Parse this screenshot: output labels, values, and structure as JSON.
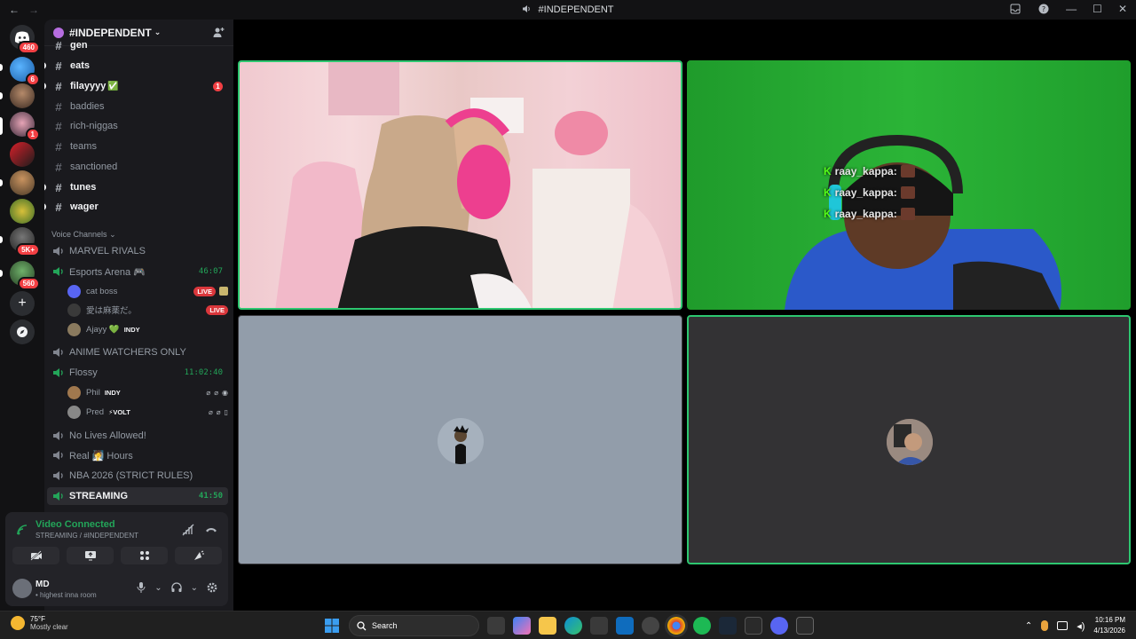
{
  "window": {
    "title": "#INDEPENDENT",
    "back": "←",
    "forward": "→",
    "minimize": "—",
    "maximize": "☐",
    "close": "✕"
  },
  "servers": [
    {
      "badge": "460"
    },
    {
      "badge": "6"
    },
    {
      "badge": ""
    },
    {
      "badge": "1"
    },
    {
      "badge": ""
    },
    {
      "badge": ""
    },
    {
      "badge": ""
    },
    {
      "badge": "5K+"
    },
    {
      "badge": "560"
    }
  ],
  "server_header": {
    "name": "#INDEPENDENT",
    "caret": "⌄"
  },
  "channels": [
    {
      "name": "gen",
      "unread": true,
      "mention": ""
    },
    {
      "name": "eats",
      "unread": true,
      "mention": ""
    },
    {
      "name": "filayyyy",
      "unread": true,
      "mention": "1",
      "emoji": "✅"
    },
    {
      "name": "baddies",
      "unread": false,
      "mention": ""
    },
    {
      "name": "rich-niggas",
      "unread": false,
      "mention": ""
    },
    {
      "name": "teams",
      "unread": false,
      "mention": ""
    },
    {
      "name": "sanctioned",
      "unread": false,
      "mention": ""
    },
    {
      "name": "tunes",
      "unread": true,
      "mention": ""
    },
    {
      "name": "wager",
      "unread": true,
      "mention": ""
    }
  ],
  "voice_category": "Voice Channels",
  "voice_channels": {
    "marvel": "MARVEL RIVALS",
    "esports": {
      "name": "Esports Arena 🎮",
      "timer": "46:07"
    },
    "esports_users": [
      {
        "name": "cat boss",
        "live": "LIVE"
      },
      {
        "name": "愛は麻薬だ。",
        "live": "LIVE"
      },
      {
        "name": "Ajayy 💚",
        "tag": "INDY"
      }
    ],
    "anime": "ANIME WATCHERS ONLY",
    "flossy": {
      "name": "Flossy",
      "timer": "11:02:40"
    },
    "flossy_users": [
      {
        "name": "Phil",
        "tag": "INDY"
      },
      {
        "name": "Pred",
        "tag": "⚡VOLT"
      }
    ],
    "nolives": "No Lives Allowed!",
    "realhours": "Real 🧖 Hours",
    "nba": "NBA 2026 (STRICT RULES)",
    "streaming": {
      "name": "STREAMING",
      "timer": "41:50"
    }
  },
  "voice_panel": {
    "status": "Video Connected",
    "location": "STREAMING / #INDEPENDENT"
  },
  "me": {
    "name": "MD",
    "status": "• highest inna room"
  },
  "stream_chat": [
    {
      "user": "raay_kappa:"
    },
    {
      "user": "raay_kappa:"
    },
    {
      "user": "raay_kappa:"
    }
  ],
  "taskbar": {
    "temp": "75°F",
    "weather": "Mostly clear",
    "search": "Search",
    "time": "10:16 PM",
    "date": "4/13/2026"
  },
  "colors": {
    "speaking": "#2dc770",
    "live": "#da373c",
    "connected": "#23a559",
    "kick": "#53fc18"
  }
}
